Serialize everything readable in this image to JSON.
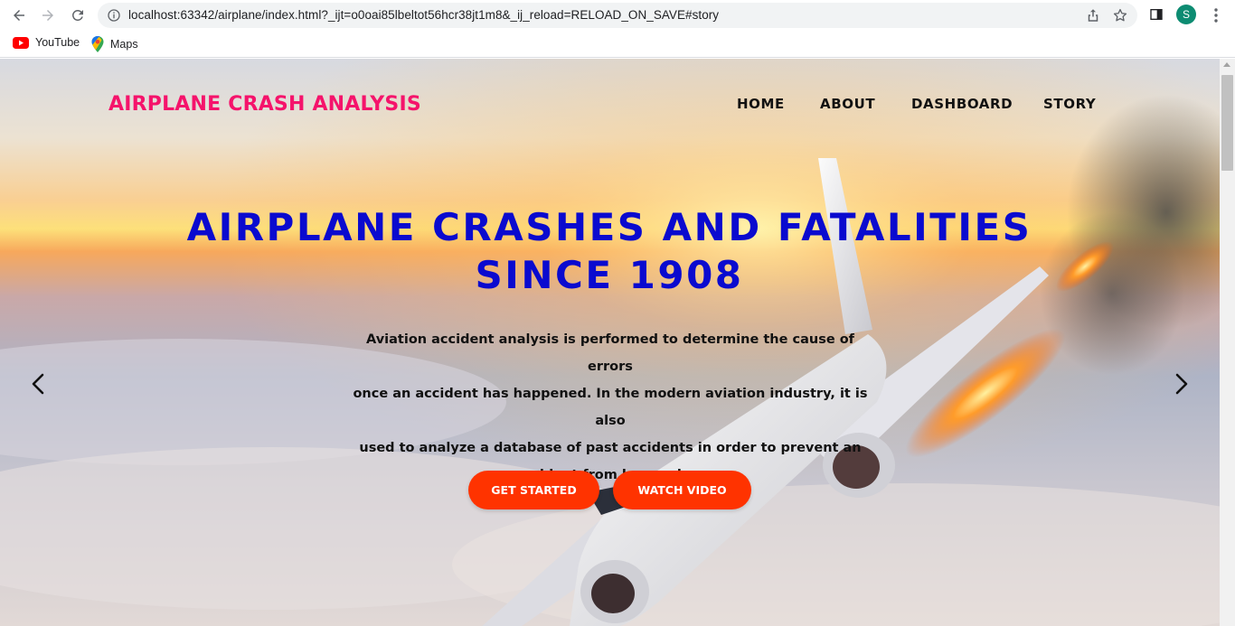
{
  "browser": {
    "url": "localhost:63342/airplane/index.html?_ijt=o0oai85lbeltot56hcr38jt1m8&_ij_reload=RELOAD_ON_SAVE#story",
    "profile_initial": "S",
    "bookmarks": [
      {
        "label": "YouTube",
        "icon": "youtube-icon"
      },
      {
        "label": "Maps",
        "icon": "maps-icon"
      }
    ]
  },
  "site": {
    "brand": "AIRPLANE CRASH ANALYSIS",
    "nav": [
      "HOME",
      "ABOUT",
      "DASHBOARD",
      "STORY"
    ]
  },
  "hero": {
    "title_line1": "AIRPLANE CRASHES AND FATALITIES",
    "title_line2": "SINCE 1908",
    "text_lines": [
      "Aviation accident analysis is performed to determine the cause of errors",
      "once an accident has happened. In the modern aviation industry, it is also",
      "used to analyze a database of past accidents in order to prevent an",
      "accident from happening."
    ],
    "buttons": [
      "GET STARTED",
      "WATCH VIDEO"
    ]
  },
  "colors": {
    "brand": "#f5136b",
    "title": "#0a0acf",
    "button": "#ff3300",
    "avatar": "#0d8c72"
  }
}
